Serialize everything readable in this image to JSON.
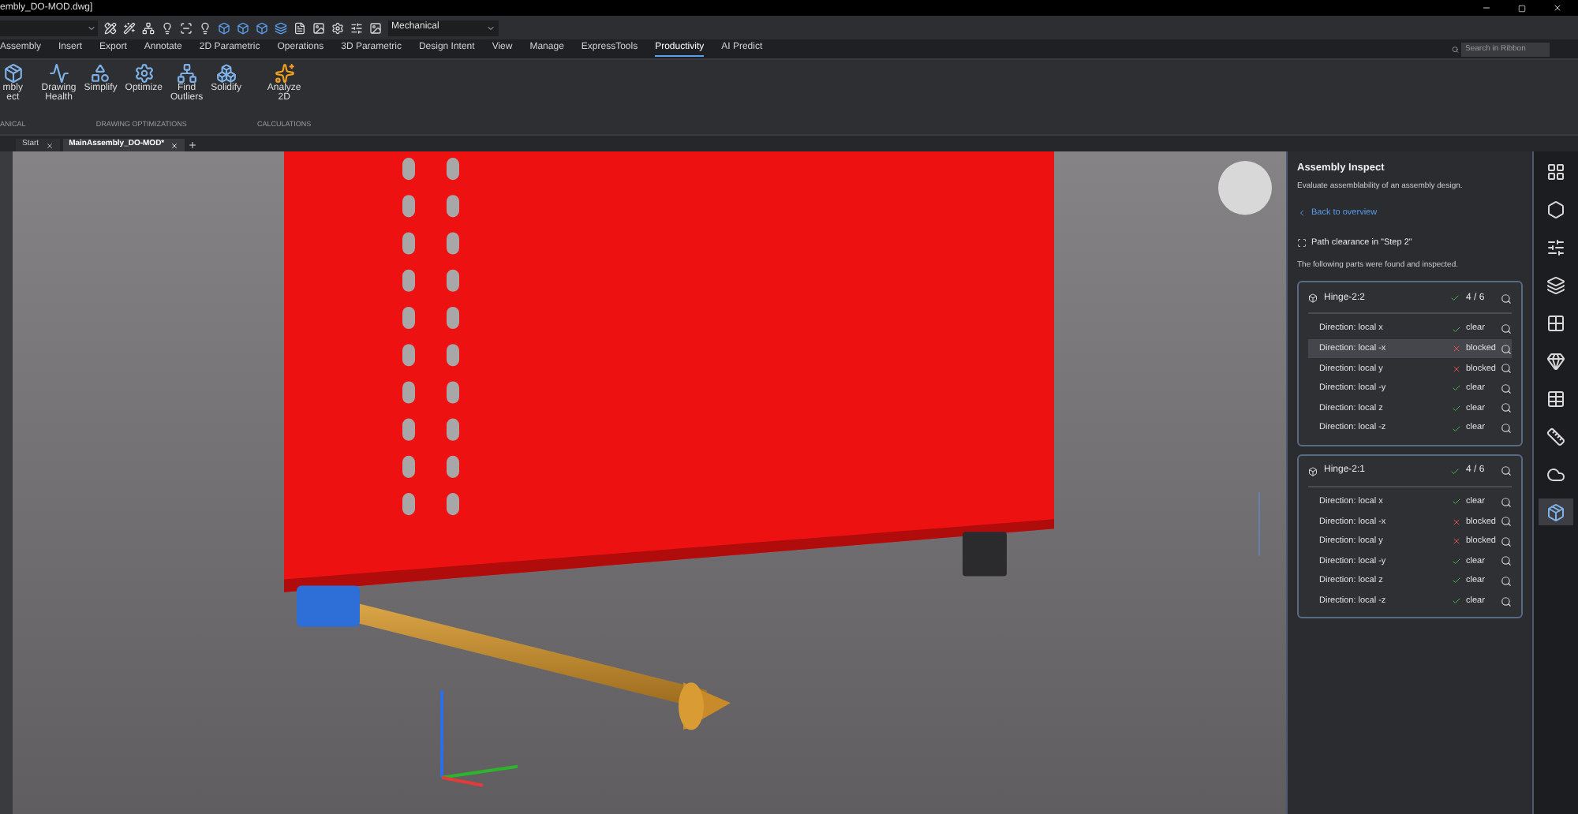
{
  "window": {
    "title": "embly_DO-MOD.dwg]"
  },
  "quick_access": {
    "workspace": "Mechanical"
  },
  "ribbon_tabs": [
    {
      "label": "Assembly",
      "selected": false
    },
    {
      "label": "Insert",
      "selected": false
    },
    {
      "label": "Export",
      "selected": false
    },
    {
      "label": "Annotate",
      "selected": false
    },
    {
      "label": "2D Parametric",
      "selected": false
    },
    {
      "label": "Operations",
      "selected": false
    },
    {
      "label": "3D Parametric",
      "selected": false
    },
    {
      "label": "Design Intent",
      "selected": false
    },
    {
      "label": "View",
      "selected": false
    },
    {
      "label": "Manage",
      "selected": false
    },
    {
      "label": "ExpressTools",
      "selected": false
    },
    {
      "label": "Productivity",
      "selected": true
    },
    {
      "label": "AI Predict",
      "selected": false
    }
  ],
  "ribbon_search": {
    "placeholder": "Search in Ribbon"
  },
  "ribbon_groups": [
    {
      "label": "ANICAL",
      "tools": [
        {
          "lines": [
            "mbly",
            "ect"
          ],
          "kind": "inspect"
        }
      ]
    },
    {
      "label": "DRAWING OPTIMIZATIONS",
      "tools": [
        {
          "lines": [
            "Drawing",
            "Health"
          ],
          "kind": "health"
        },
        {
          "lines": [
            "Simplify"
          ],
          "kind": "simplify"
        },
        {
          "lines": [
            "Optimize"
          ],
          "kind": "optimize"
        },
        {
          "lines": [
            "Find",
            "Outliers"
          ],
          "kind": "outliers"
        },
        {
          "lines": [
            "Solidify"
          ],
          "kind": "solidify"
        }
      ]
    },
    {
      "label": "CALCULATIONS",
      "tools": [
        {
          "lines": [
            "Analyze",
            "2D"
          ],
          "kind": "analyze"
        }
      ]
    }
  ],
  "doc_tabs": [
    {
      "label": "Start",
      "selected": false
    },
    {
      "label": "MainAssembly_DO-MOD*",
      "selected": true
    }
  ],
  "panel": {
    "title": "Assembly Inspect",
    "subtitle": "Evaluate assemblability of an assembly design.",
    "back_link": "Back to overview",
    "step": "Path clearance in \"Step 2\"",
    "note": "The following parts were found and inspected.",
    "parts": [
      {
        "name": "Hinge-2:2",
        "count": "4 / 6",
        "directions": [
          {
            "label": "Direction: local x",
            "status": "clear",
            "kind": "clear",
            "selected": false
          },
          {
            "label": "Direction: local -x",
            "status": "blocked",
            "kind": "blocked",
            "selected": true
          },
          {
            "label": "Direction: local y",
            "status": "blocked",
            "kind": "blocked",
            "selected": false
          },
          {
            "label": "Direction: local -y",
            "status": "clear",
            "kind": "clear",
            "selected": false
          },
          {
            "label": "Direction: local z",
            "status": "clear",
            "kind": "clear",
            "selected": false
          },
          {
            "label": "Direction: local -z",
            "status": "clear",
            "kind": "clear",
            "selected": false
          }
        ]
      },
      {
        "name": "Hinge-2:1",
        "count": "4 / 6",
        "directions": [
          {
            "label": "Direction: local x",
            "status": "clear",
            "kind": "clear",
            "selected": false
          },
          {
            "label": "Direction: local -x",
            "status": "blocked",
            "kind": "blocked",
            "selected": false
          },
          {
            "label": "Direction: local y",
            "status": "blocked",
            "kind": "blocked",
            "selected": false
          },
          {
            "label": "Direction: local -y",
            "status": "clear",
            "kind": "clear",
            "selected": false
          },
          {
            "label": "Direction: local z",
            "status": "clear",
            "kind": "clear",
            "selected": false
          },
          {
            "label": "Direction: local -z",
            "status": "clear",
            "kind": "clear",
            "selected": false
          }
        ]
      }
    ]
  },
  "side_icons": [
    {
      "selected": false
    },
    {
      "selected": false
    },
    {
      "selected": false
    },
    {
      "selected": false
    },
    {
      "selected": false
    },
    {
      "selected": false
    },
    {
      "selected": false
    },
    {
      "selected": false
    },
    {
      "selected": false
    },
    {
      "selected": true
    }
  ]
}
